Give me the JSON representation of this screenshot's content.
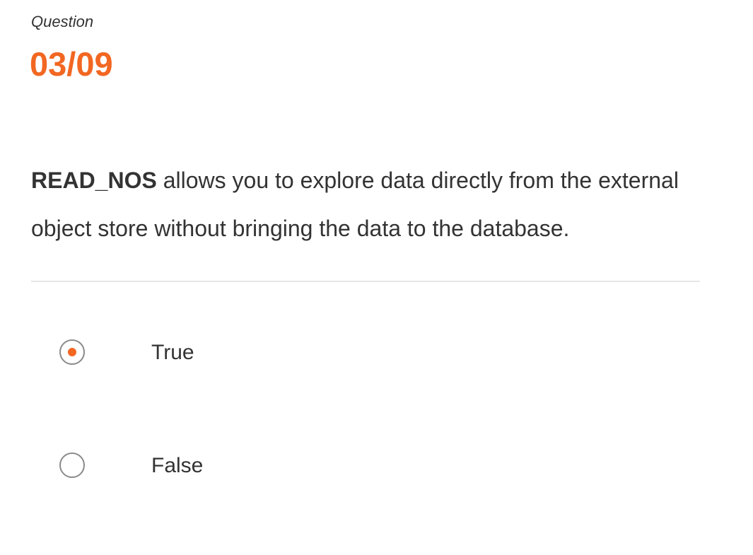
{
  "question": {
    "label": "Question",
    "counter": "03/09",
    "keyword": "READ_NOS",
    "text": " allows you to explore data directly from the external object store without bringing the data to the database."
  },
  "options": [
    {
      "label": "True",
      "selected": true
    },
    {
      "label": "False",
      "selected": false
    }
  ],
  "colors": {
    "accent": "#f26722",
    "text": "#333333",
    "radio_border": "#8a8a8a",
    "divider": "#e6e6e6"
  },
  "icons": {
    "radio_selected": "radio-selected-icon",
    "radio_unselected": "radio-unselected-icon"
  }
}
